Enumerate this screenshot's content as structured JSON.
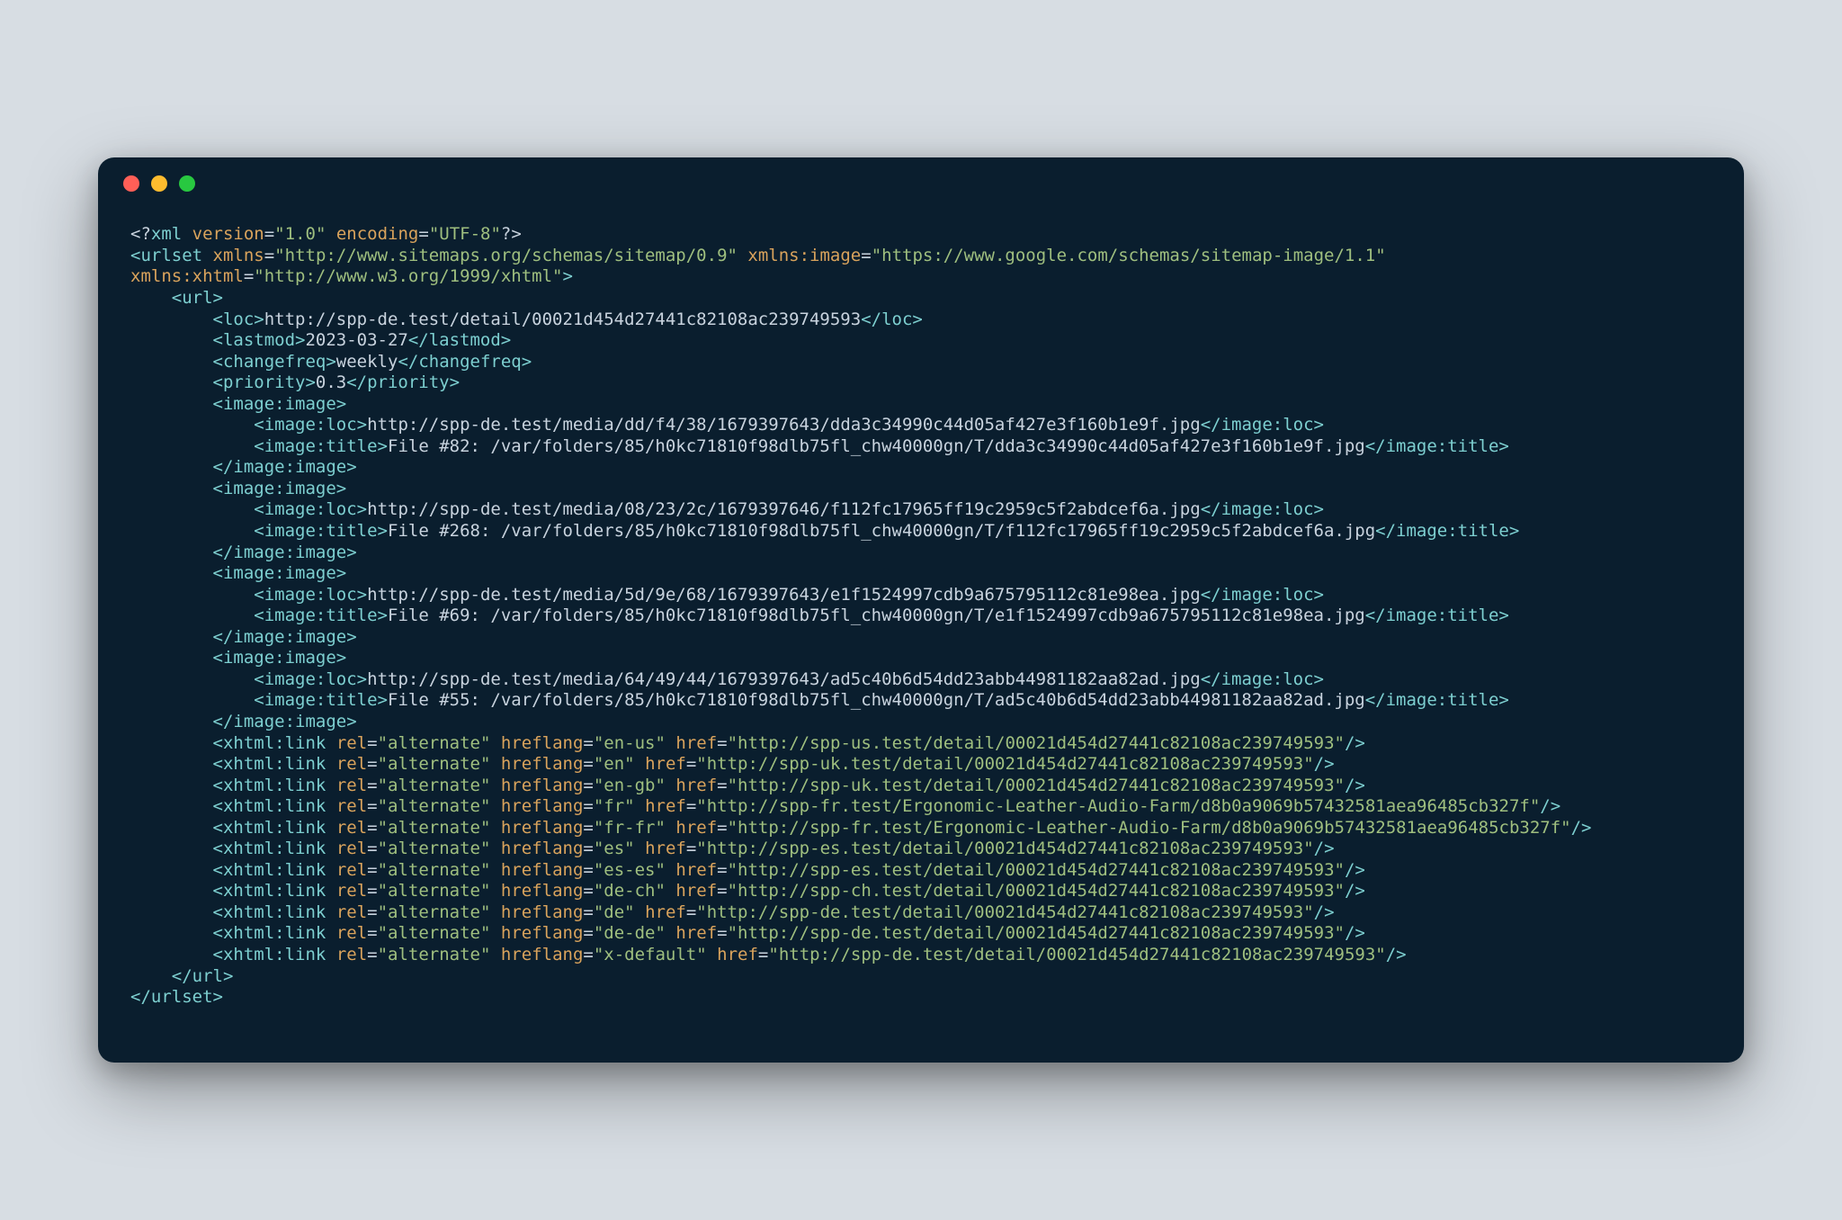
{
  "colors": {
    "bg": "#0a1e2e",
    "page": "#d7dde3",
    "tag": "#7dcfd0",
    "attr": "#d9a35c",
    "val": "#9fbf7f",
    "text": "#c8d3de"
  },
  "xml_decl": {
    "version": "1.0",
    "encoding": "UTF-8"
  },
  "urlset_attrs": {
    "xmlns": "http://www.sitemaps.org/schemas/sitemap/0.9",
    "xmlns_image": "https://www.google.com/schemas/sitemap-image/1.1",
    "xmlns_xhtml": "http://www.w3.org/1999/xhtml"
  },
  "url": {
    "loc": "http://spp-de.test/detail/00021d454d27441c82108ac239749593",
    "lastmod": "2023-03-27",
    "changefreq": "weekly",
    "priority": "0.3",
    "images": [
      {
        "loc": "http://spp-de.test/media/dd/f4/38/1679397643/dda3c34990c44d05af427e3f160b1e9f.jpg",
        "title": "File #82: /var/folders/85/h0kc71810f98dlb75fl_chw40000gn/T/dda3c34990c44d05af427e3f160b1e9f.jpg"
      },
      {
        "loc": "http://spp-de.test/media/08/23/2c/1679397646/f112fc17965ff19c2959c5f2abdcef6a.jpg",
        "title": "File #268: /var/folders/85/h0kc71810f98dlb75fl_chw40000gn/T/f112fc17965ff19c2959c5f2abdcef6a.jpg"
      },
      {
        "loc": "http://spp-de.test/media/5d/9e/68/1679397643/e1f1524997cdb9a675795112c81e98ea.jpg",
        "title": "File #69: /var/folders/85/h0kc71810f98dlb75fl_chw40000gn/T/e1f1524997cdb9a675795112c81e98ea.jpg"
      },
      {
        "loc": "http://spp-de.test/media/64/49/44/1679397643/ad5c40b6d54dd23abb44981182aa82ad.jpg",
        "title": "File #55: /var/folders/85/h0kc71810f98dlb75fl_chw40000gn/T/ad5c40b6d54dd23abb44981182aa82ad.jpg"
      }
    ],
    "links": [
      {
        "rel": "alternate",
        "hreflang": "en-us",
        "href": "http://spp-us.test/detail/00021d454d27441c82108ac239749593"
      },
      {
        "rel": "alternate",
        "hreflang": "en",
        "href": "http://spp-uk.test/detail/00021d454d27441c82108ac239749593"
      },
      {
        "rel": "alternate",
        "hreflang": "en-gb",
        "href": "http://spp-uk.test/detail/00021d454d27441c82108ac239749593"
      },
      {
        "rel": "alternate",
        "hreflang": "fr",
        "href": "http://spp-fr.test/Ergonomic-Leather-Audio-Farm/d8b0a9069b57432581aea96485cb327f"
      },
      {
        "rel": "alternate",
        "hreflang": "fr-fr",
        "href": "http://spp-fr.test/Ergonomic-Leather-Audio-Farm/d8b0a9069b57432581aea96485cb327f"
      },
      {
        "rel": "alternate",
        "hreflang": "es",
        "href": "http://spp-es.test/detail/00021d454d27441c82108ac239749593"
      },
      {
        "rel": "alternate",
        "hreflang": "es-es",
        "href": "http://spp-es.test/detail/00021d454d27441c82108ac239749593"
      },
      {
        "rel": "alternate",
        "hreflang": "de-ch",
        "href": "http://spp-ch.test/detail/00021d454d27441c82108ac239749593"
      },
      {
        "rel": "alternate",
        "hreflang": "de",
        "href": "http://spp-de.test/detail/00021d454d27441c82108ac239749593"
      },
      {
        "rel": "alternate",
        "hreflang": "de-de",
        "href": "http://spp-de.test/detail/00021d454d27441c82108ac239749593"
      },
      {
        "rel": "alternate",
        "hreflang": "x-default",
        "href": "http://spp-de.test/detail/00021d454d27441c82108ac239749593"
      }
    ]
  }
}
